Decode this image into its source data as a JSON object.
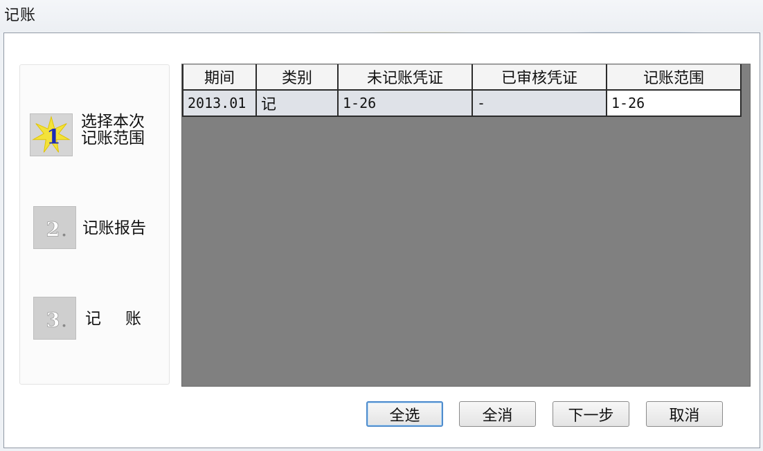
{
  "window": {
    "title": "记账"
  },
  "steps": [
    {
      "number": "1",
      "label": "选择本次记账范围",
      "active": true
    },
    {
      "number": "2",
      "label": "记账报告",
      "active": false
    },
    {
      "number": "3",
      "label": "记　账",
      "active": false
    }
  ],
  "grid": {
    "headers": [
      "期间",
      "类别",
      "未记账凭证",
      "已审核凭证",
      "记账范围"
    ],
    "rows": [
      [
        "2013.01",
        "记",
        "1-26",
        "-",
        "1-26"
      ]
    ]
  },
  "buttons": {
    "select_all": "全选",
    "clear_all": "全消",
    "next": "下一步",
    "cancel": "取消"
  },
  "colors": {
    "grid_background": "#808080",
    "row_background": "#dfe2e8",
    "default_button_border": "#4f8ccd"
  }
}
